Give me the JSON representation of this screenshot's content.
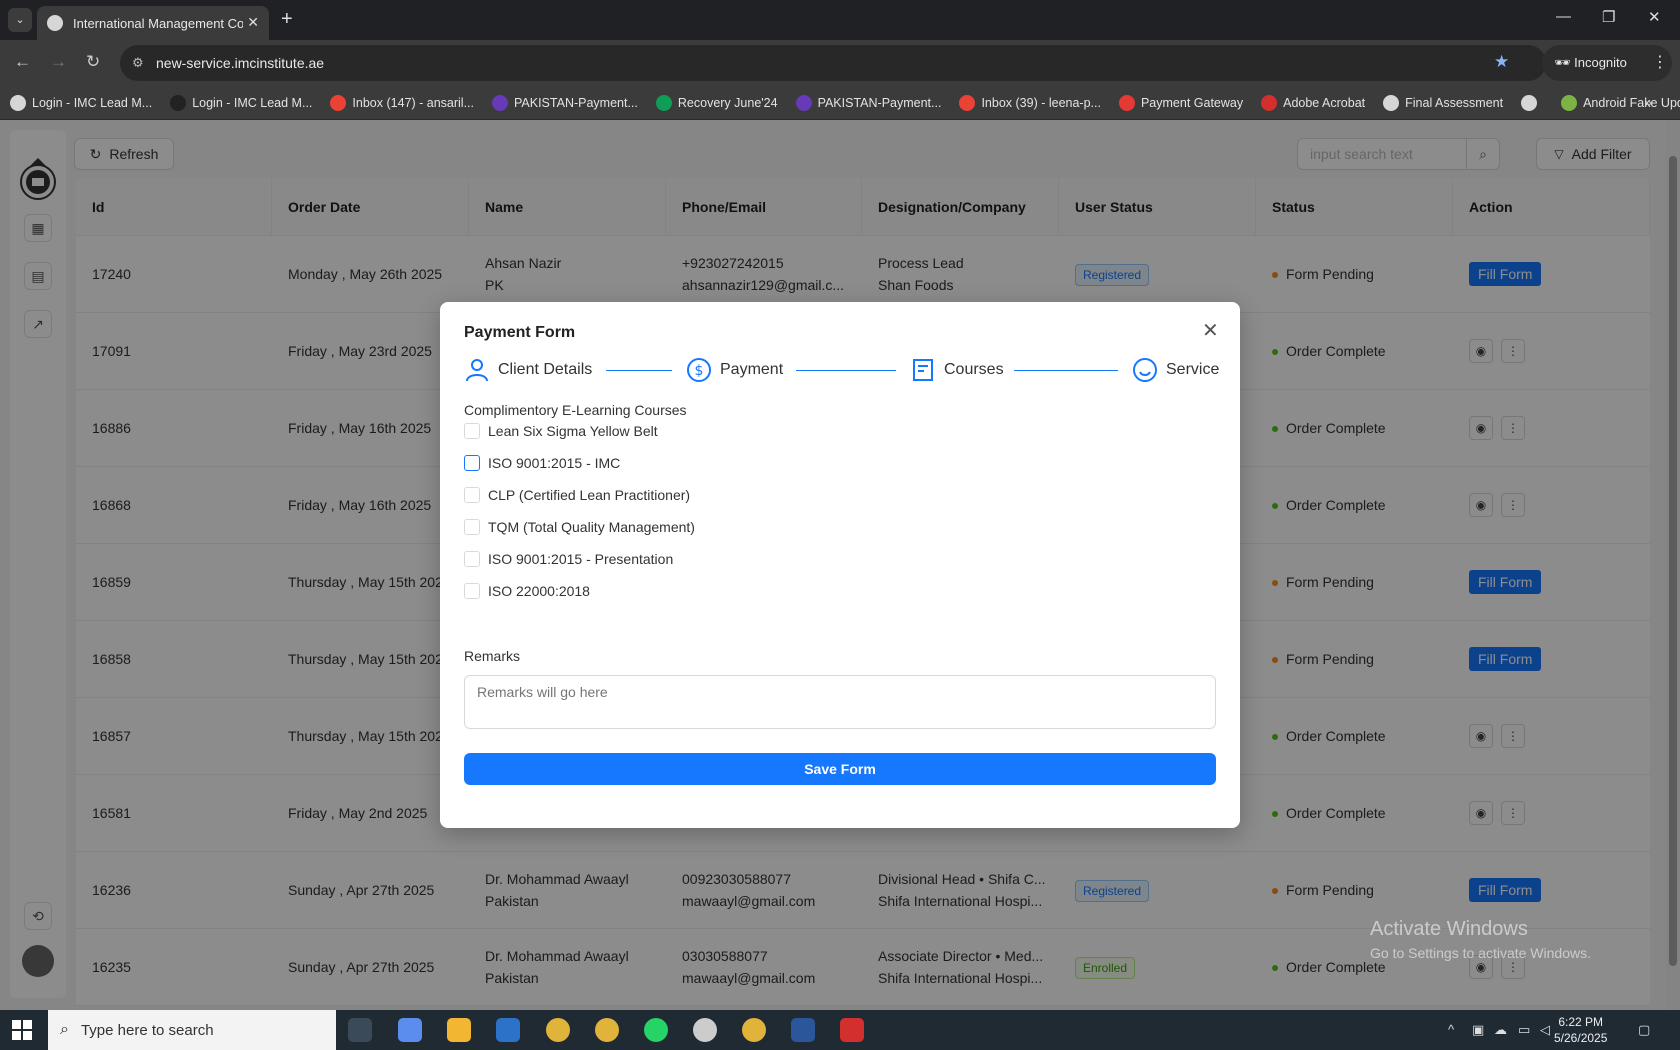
{
  "browser": {
    "tab_title": "International Management Con",
    "url": "new-service.imcinstitute.ae",
    "incognito_label": "Incognito",
    "bookmarks": [
      {
        "label": "Login - IMC Lead M...",
        "icon": "globe-icon",
        "color": "#d6d6d6"
      },
      {
        "label": "Login - IMC Lead M...",
        "icon": "globe-icon",
        "color": "#222222"
      },
      {
        "label": "Inbox (147) - ansaril...",
        "icon": "gmail-icon",
        "color": "#ea4335"
      },
      {
        "label": "PAKISTAN-Payment...",
        "icon": "forms-icon",
        "color": "#673ab7"
      },
      {
        "label": "Recovery June'24",
        "icon": "sheets-icon",
        "color": "#0f9d58"
      },
      {
        "label": "PAKISTAN-Payment...",
        "icon": "forms-icon",
        "color": "#673ab7"
      },
      {
        "label": "Inbox (39) - leena-p...",
        "icon": "gmail-icon",
        "color": "#ea4335"
      },
      {
        "label": "Payment Gateway",
        "icon": "gateway-icon",
        "color": "#e53935"
      },
      {
        "label": "Adobe Acrobat",
        "icon": "acrobat-icon",
        "color": "#d32f2f"
      },
      {
        "label": "Final Assessment",
        "icon": "globe-icon",
        "color": "#d6d6d6"
      },
      {
        "label": "",
        "icon": "globe-icon",
        "color": "#d6d6d6"
      },
      {
        "label": "Android Fake Updat...",
        "icon": "android-icon",
        "color": "#7cb342"
      }
    ]
  },
  "toolbar": {
    "refresh_label": "Refresh",
    "search_placeholder": "input search text",
    "add_filter_label": "Add Filter"
  },
  "table": {
    "headers": [
      "Id",
      "Order Date",
      "Name",
      "Phone/Email",
      "Designation/Company",
      "User Status",
      "Status",
      "Action"
    ],
    "rows": [
      {
        "id": "17240",
        "date": "Monday , May 26th 2025",
        "name1": "Ahsan Nazir",
        "name2": "PK",
        "phone": "+923027242015",
        "email": "ahsannazir129@gmail.c...",
        "desig": "Process Lead",
        "company": "Shan Foods",
        "user_status": "Registered",
        "status": "Form Pending",
        "action": "fill"
      },
      {
        "id": "17091",
        "date": "Friday , May 23rd 2025",
        "name1": "",
        "name2": "",
        "phone": "",
        "email": "",
        "desig": "",
        "company": "",
        "user_status": "",
        "status": "Order Complete",
        "action": "icons"
      },
      {
        "id": "16886",
        "date": "Friday , May 16th 2025",
        "name1": "",
        "name2": "",
        "phone": "",
        "email": "",
        "desig": "",
        "company": "",
        "user_status": "",
        "status": "Order Complete",
        "action": "icons"
      },
      {
        "id": "16868",
        "date": "Friday , May 16th 2025",
        "name1": "",
        "name2": "",
        "phone": "",
        "email": "",
        "desig": "",
        "company": "",
        "user_status": "",
        "status": "Order Complete",
        "action": "icons"
      },
      {
        "id": "16859",
        "date": "Thursday , May 15th 202",
        "name1": "",
        "name2": "",
        "phone": "",
        "email": "",
        "desig": "",
        "company": "",
        "user_status": "",
        "status": "Form Pending",
        "action": "fill"
      },
      {
        "id": "16858",
        "date": "Thursday , May 15th 202",
        "name1": "",
        "name2": "",
        "phone": "",
        "email": "",
        "desig": "",
        "company": "",
        "user_status": "",
        "status": "Form Pending",
        "action": "fill"
      },
      {
        "id": "16857",
        "date": "Thursday , May 15th 202",
        "name1": "",
        "name2": "",
        "phone": "",
        "email": "",
        "desig": "",
        "company": "",
        "user_status": "",
        "status": "Order Complete",
        "action": "icons"
      },
      {
        "id": "16581",
        "date": "Friday , May 2nd 2025",
        "name1": "",
        "name2": "",
        "phone": "",
        "email": "",
        "desig": "",
        "company": "",
        "user_status": "",
        "status": "Order Complete",
        "action": "icons"
      },
      {
        "id": "16236",
        "date": "Sunday , Apr 27th 2025",
        "name1": "Dr. Mohammad Awaayl",
        "name2": "Pakistan",
        "phone": "00923030588077",
        "email": "mawaayl@gmail.com",
        "desig": "Divisional Head • Shifa C...",
        "company": "Shifa International Hospi...",
        "user_status": "Registered",
        "status": "Form Pending",
        "action": "fill"
      },
      {
        "id": "16235",
        "date": "Sunday , Apr 27th 2025",
        "name1": "Dr. Mohammad Awaayl",
        "name2": "Pakistan",
        "phone": "03030588077",
        "email": "mawaayl@gmail.com",
        "desig": "Associate Director • Med...",
        "company": "Shifa International Hospi...",
        "user_status": "Enrolled",
        "status": "Order Complete",
        "action": "icons"
      }
    ],
    "fill_form_label": "Fill Form",
    "pending_color": "#fa8c16",
    "complete_color": "#52c41a"
  },
  "modal": {
    "title": "Payment Form",
    "steps": [
      "Client Details",
      "Payment",
      "Courses",
      "Service"
    ],
    "section_label": "Complimentory E-Learning Courses",
    "courses": [
      "Lean Six Sigma Yellow Belt",
      "ISO 9001:2015 - IMC",
      "CLP (Certified Lean Practitioner)",
      "TQM (Total Quality Management)",
      "ISO 9001:2015 - Presentation",
      "ISO 22000:2018"
    ],
    "remarks_label": "Remarks",
    "remarks_placeholder": "Remarks will go here",
    "save_label": "Save Form",
    "accent": "#1677ff"
  },
  "watermark": {
    "title": "Activate Windows",
    "subtitle": "Go to Settings to activate Windows."
  },
  "taskbar": {
    "search_placeholder": "Type here to search",
    "time": "6:22 PM",
    "date": "5/26/2025"
  }
}
